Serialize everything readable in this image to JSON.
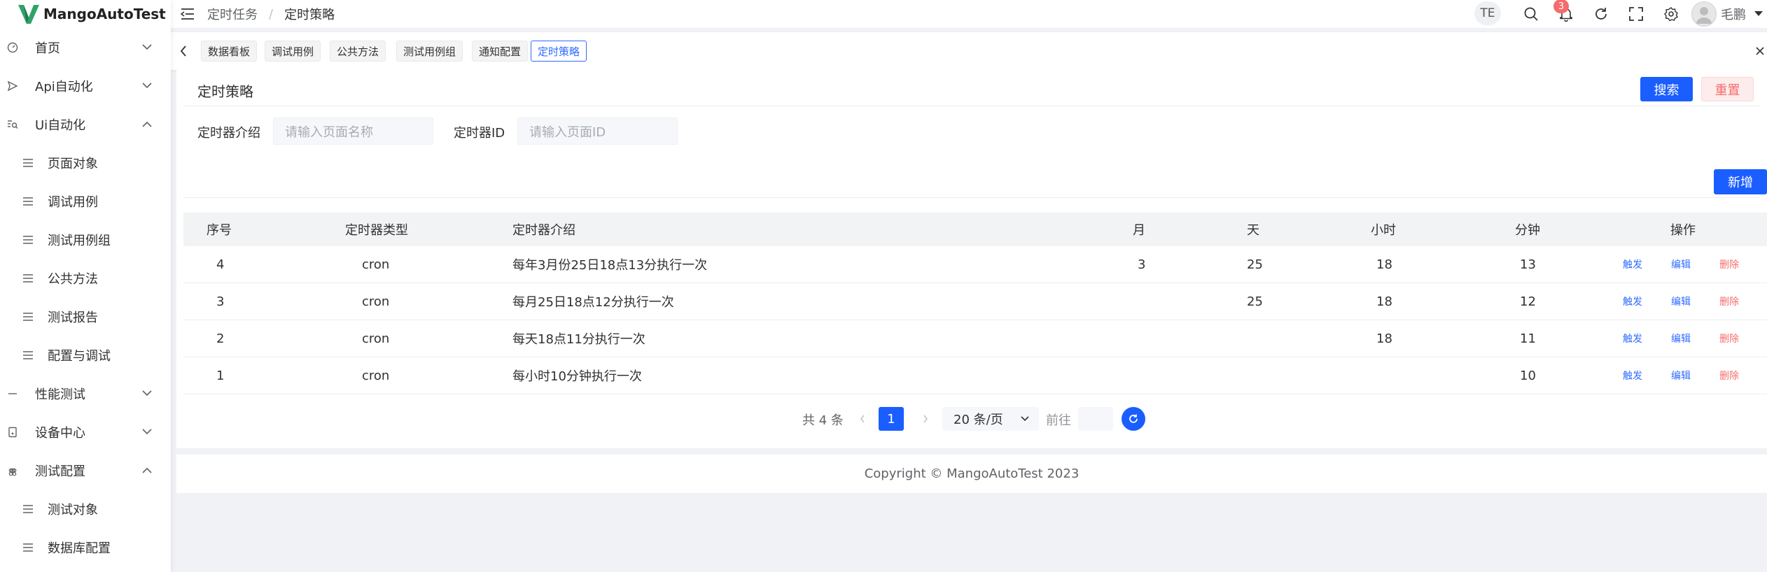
{
  "app": {
    "logo_text": "MangoAutoTest"
  },
  "sidebar": {
    "menu": [
      {
        "label": "首页",
        "icon": "dashboard-icon",
        "expanded": false
      },
      {
        "label": "Api自动化",
        "icon": "send-icon",
        "expanded": false
      },
      {
        "label": "Ui自动化",
        "icon": "search-doc-icon",
        "expanded": true,
        "children": [
          "页面对象",
          "调试用例",
          "测试用例组",
          "公共方法",
          "测试报告",
          "配置与调试"
        ]
      },
      {
        "label": "性能测试",
        "icon": "minus-icon",
        "expanded": false
      },
      {
        "label": "设备中心",
        "icon": "device-icon",
        "expanded": false
      },
      {
        "label": "测试配置",
        "icon": "command-icon",
        "expanded": true,
        "children": [
          "测试对象",
          "数据库配置"
        ]
      }
    ]
  },
  "header": {
    "breadcrumb": [
      "定时任务",
      "定时策略"
    ],
    "lang": "TE",
    "notification_count": "3",
    "user_name": "毛鹏"
  },
  "tags": [
    "数据看板",
    "调试用例",
    "公共方法",
    "测试用例组",
    "通知配置",
    "定时策略"
  ],
  "active_tag": "定时策略",
  "page": {
    "title": "定时策略",
    "search_label": "搜索",
    "reset_label": "重置",
    "add_label": "新增",
    "filters": [
      {
        "label": "定时器介绍",
        "placeholder": "请输入页面名称"
      },
      {
        "label": "定时器ID",
        "placeholder": "请输入页面ID"
      }
    ]
  },
  "table": {
    "columns": [
      "序号",
      "定时器类型",
      "定时器介绍",
      "月",
      "天",
      "小时",
      "分钟",
      "操作"
    ],
    "rows": [
      {
        "id": "4",
        "type": "cron",
        "desc": "每年3月份25日18点13分执行一次",
        "month": "3",
        "day": "25",
        "hour": "18",
        "minute": "13"
      },
      {
        "id": "3",
        "type": "cron",
        "desc": "每月25日18点12分执行一次",
        "month": "",
        "day": "25",
        "hour": "18",
        "minute": "12"
      },
      {
        "id": "2",
        "type": "cron",
        "desc": "每天18点11分执行一次",
        "month": "",
        "day": "",
        "hour": "18",
        "minute": "11"
      },
      {
        "id": "1",
        "type": "cron",
        "desc": "每小时10分钟执行一次",
        "month": "",
        "day": "",
        "hour": "",
        "minute": "10"
      }
    ],
    "actions": {
      "trigger": "触发",
      "edit": "编辑",
      "delete": "删除"
    }
  },
  "pagination": {
    "total": "共 4 条",
    "current_page": "1",
    "page_size": "20 条/页",
    "goto_label": "前往"
  },
  "footer": {
    "copyright": "Copyright © MangoAutoTest 2023"
  },
  "colors": {
    "primary": "#1a5eff",
    "danger": "#f56c6c",
    "logo_green": "#2fa36b"
  }
}
